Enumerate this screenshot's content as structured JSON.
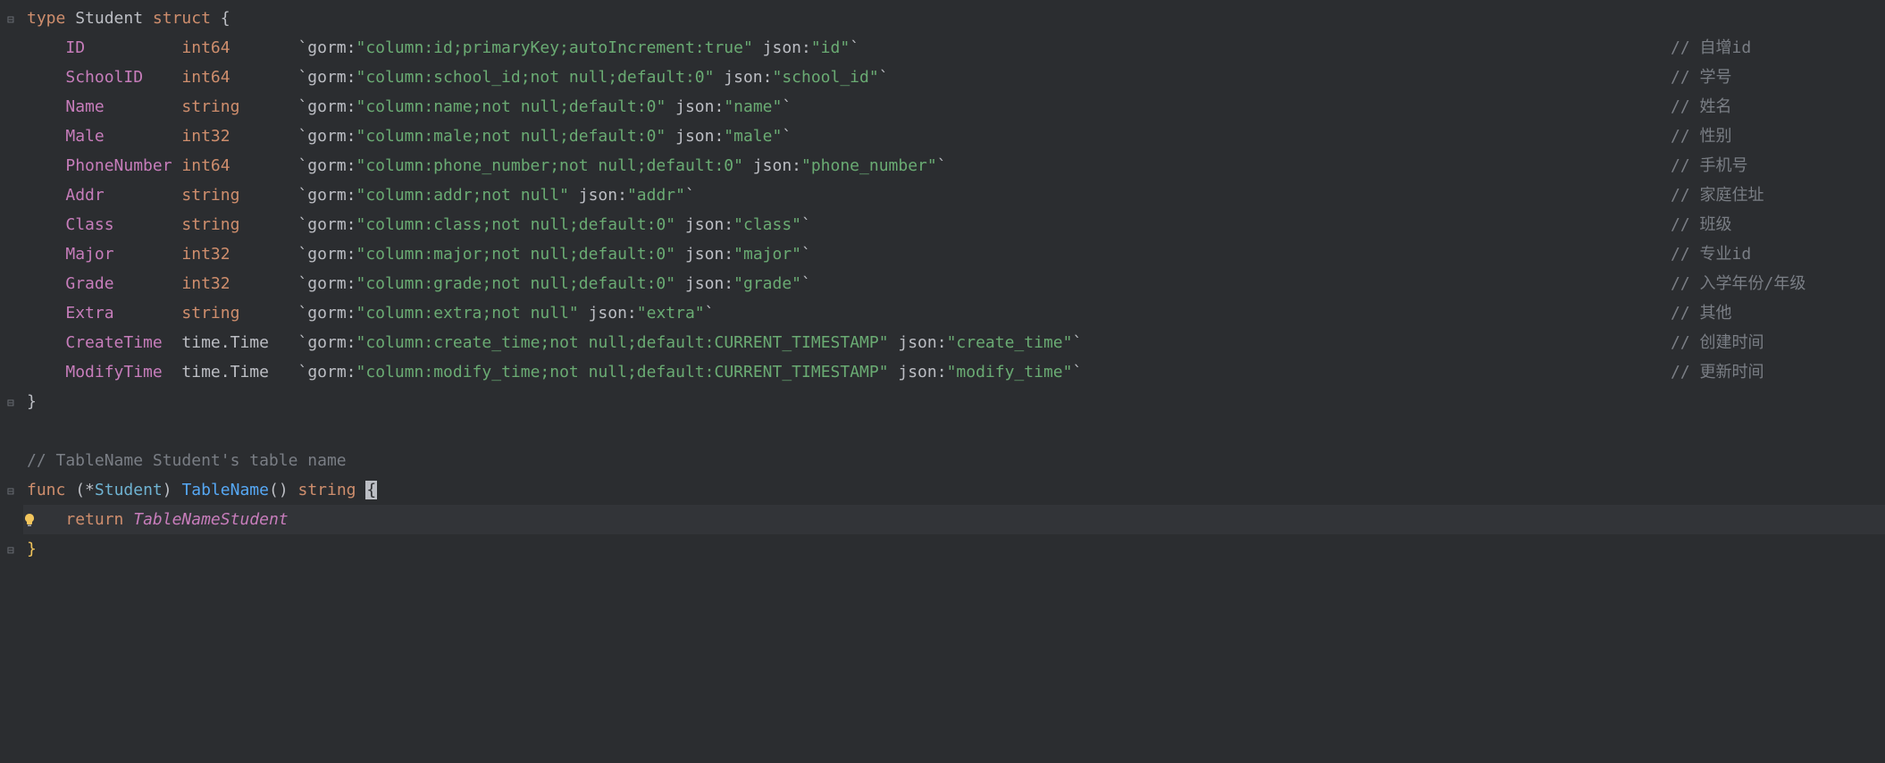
{
  "code": {
    "l1": {
      "kw_type": "type",
      "name": "Student",
      "kw_struct": "struct",
      "brace": "{"
    },
    "fields": [
      {
        "name": "ID",
        "type": "int64",
        "tag_open": "`gorm:",
        "gorm": "\"column:id;primaryKey;autoIncrement:true\"",
        "jsonkey": " json:",
        "json": "\"id\"",
        "tag_close": "`",
        "comment": "// 自增id"
      },
      {
        "name": "SchoolID",
        "type": "int64",
        "tag_open": "`gorm:",
        "gorm": "\"column:school_id;not null;default:0\"",
        "jsonkey": " json:",
        "json": "\"school_id\"",
        "tag_close": "`",
        "comment": "// 学号"
      },
      {
        "name": "Name",
        "type": "string",
        "tag_open": "`gorm:",
        "gorm": "\"column:name;not null;default:0\"",
        "jsonkey": " json:",
        "json": "\"name\"",
        "tag_close": "`",
        "comment": "// 姓名"
      },
      {
        "name": "Male",
        "type": "int32",
        "tag_open": "`gorm:",
        "gorm": "\"column:male;not null;default:0\"",
        "jsonkey": " json:",
        "json": "\"male\"",
        "tag_close": "`",
        "comment": "// 性别"
      },
      {
        "name": "PhoneNumber",
        "type": "int64",
        "tag_open": "`gorm:",
        "gorm": "\"column:phone_number;not null;default:0\"",
        "jsonkey": " json:",
        "json": "\"phone_number\"",
        "tag_close": "`",
        "comment": "// 手机号"
      },
      {
        "name": "Addr",
        "type": "string",
        "tag_open": "`gorm:",
        "gorm": "\"column:addr;not null\"",
        "jsonkey": " json:",
        "json": "\"addr\"",
        "tag_close": "`",
        "comment": "// 家庭住址"
      },
      {
        "name": "Class",
        "type": "string",
        "tag_open": "`gorm:",
        "gorm": "\"column:class;not null;default:0\"",
        "jsonkey": " json:",
        "json": "\"class\"",
        "tag_close": "`",
        "comment": "// 班级"
      },
      {
        "name": "Major",
        "type": "int32",
        "tag_open": "`gorm:",
        "gorm": "\"column:major;not null;default:0\"",
        "jsonkey": " json:",
        "json": "\"major\"",
        "tag_close": "`",
        "comment": "// 专业id"
      },
      {
        "name": "Grade",
        "type": "int32",
        "tag_open": "`gorm:",
        "gorm": "\"column:grade;not null;default:0\"",
        "jsonkey": " json:",
        "json": "\"grade\"",
        "tag_close": "`",
        "comment": "// 入学年份/年级"
      },
      {
        "name": "Extra",
        "type": "string",
        "tag_open": "`gorm:",
        "gorm": "\"column:extra;not null\"",
        "jsonkey": " json:",
        "json": "\"extra\"",
        "tag_close": "`",
        "comment": "// 其他"
      },
      {
        "name": "CreateTime",
        "type": "time.Time",
        "tag_open": "`gorm:",
        "gorm": "\"column:create_time;not null;default:CURRENT_TIMESTAMP\"",
        "jsonkey": " json:",
        "json": "\"create_time\"",
        "tag_close": "`",
        "comment": "// 创建时间"
      },
      {
        "name": "ModifyTime",
        "type": "time.Time",
        "tag_open": "`gorm:",
        "gorm": "\"column:modify_time;not null;default:CURRENT_TIMESTAMP\"",
        "jsonkey": " json:",
        "json": "\"modify_time\"",
        "tag_close": "`",
        "comment": "// 更新时间"
      }
    ],
    "close_brace": "}",
    "comment_func": "// TableName Student's table name",
    "func_line": {
      "kw_func": "func",
      "recv_open": "(*",
      "recv_type": "Student",
      "recv_close": ")",
      "fn_name": "TableName",
      "parens": "()",
      "ret": "string",
      "brace": "{"
    },
    "return_line": {
      "kw_return": "return",
      "ident": "TableNameStudent"
    },
    "close_func": "}"
  },
  "layout": {
    "col_field": 12,
    "col_type": 12,
    "tag_col": 67,
    "comment_col": 137
  }
}
